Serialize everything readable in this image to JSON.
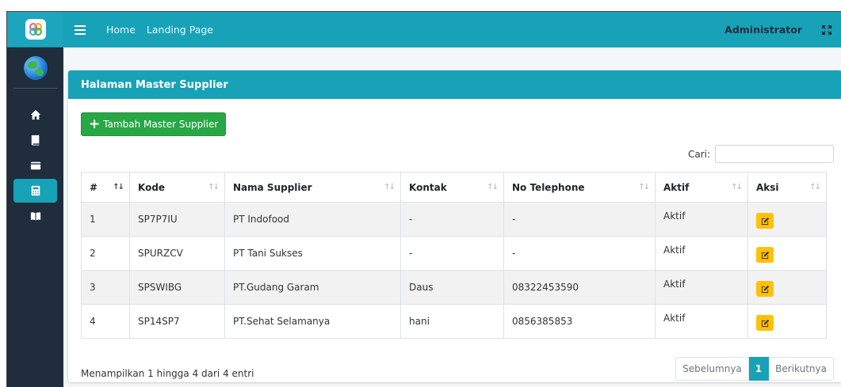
{
  "navbar": {
    "links": [
      "Home",
      "Landing Page"
    ],
    "user": "Administrator"
  },
  "sidebar": {
    "icons": [
      "home-icon",
      "book-icon",
      "wallet-icon",
      "calculator-icon",
      "book-open-icon"
    ],
    "active_index": 3
  },
  "card": {
    "title": "Halaman Master Supplier",
    "add_button": "Tambah Master Supplier",
    "search_label": "Cari:",
    "search_value": ""
  },
  "table": {
    "columns": [
      "#",
      "Kode",
      "Nama Supplier",
      "Kontak",
      "No Telephone",
      "Aktif",
      "Aksi"
    ],
    "rows": [
      {
        "no": "1",
        "kode": "SP7P7IU",
        "nama": "PT Indofood",
        "kontak": "-",
        "telp": "-",
        "aktif": "Aktif"
      },
      {
        "no": "2",
        "kode": "SPURZCV",
        "nama": "PT Tani Sukses",
        "kontak": "-",
        "telp": "-",
        "aktif": "Aktif"
      },
      {
        "no": "3",
        "kode": "SPSWIBG",
        "nama": "PT.Gudang Garam",
        "kontak": "Daus",
        "telp": "08322453590",
        "aktif": "Aktif"
      },
      {
        "no": "4",
        "kode": "SP14SP7",
        "nama": "PT.Sehat Selamanya",
        "kontak": "hani",
        "telp": "0856385853",
        "aktif": "Aktif"
      }
    ]
  },
  "footer": {
    "info": "Menampilkan 1 hingga 4 dari 4 entri",
    "prev": "Sebelumnya",
    "current_page": "1",
    "next": "Berikutnya"
  },
  "colors": {
    "primary": "#17a2b8",
    "sidebar": "#1f2d3d",
    "success": "#28a745",
    "warning": "#ffc107"
  }
}
